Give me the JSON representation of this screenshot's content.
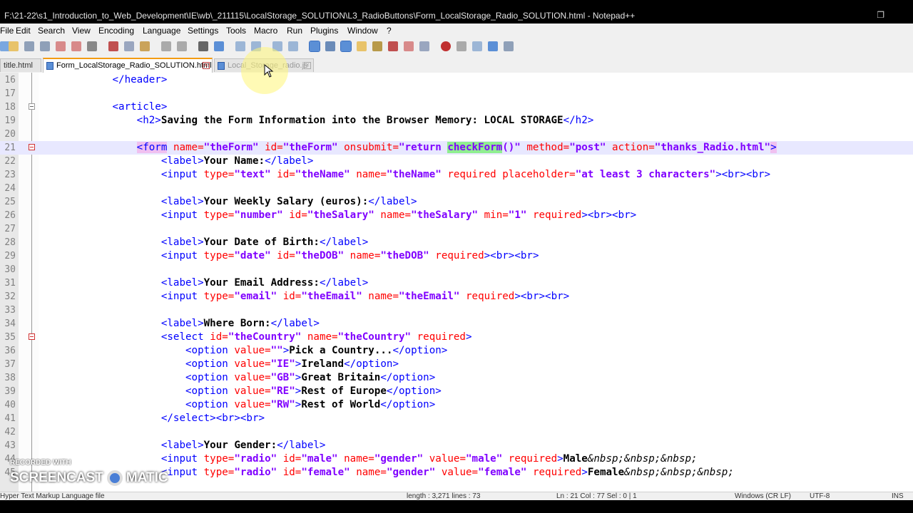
{
  "window": {
    "title": "F:\\21-22\\s1_Introduction_to_Web_Development\\IE\\wb\\_211115\\LocalStorage_SOLUTION\\L3_RadioButtons\\Form_LocalStorage_Radio_SOLUTION.html - Notepad++"
  },
  "menu": [
    "File",
    "Edit",
    "Search",
    "View",
    "Encoding",
    "Language",
    "Settings",
    "Tools",
    "Macro",
    "Run",
    "Plugins",
    "Window",
    "?"
  ],
  "tabs": [
    {
      "label": "title.html",
      "state": "inactive"
    },
    {
      "label": "Form_LocalStorage_Radio_SOLUTION.html",
      "state": "active"
    },
    {
      "label": "Local_Storage_radio.js",
      "state": "inactive"
    }
  ],
  "editor": {
    "lines": [
      {
        "num": "16",
        "fold": "line"
      },
      {
        "num": "17",
        "fold": "line"
      },
      {
        "num": "18",
        "fold": "box"
      },
      {
        "num": "19",
        "fold": "line"
      },
      {
        "num": "20",
        "fold": "line"
      },
      {
        "num": "21",
        "fold": "box-red",
        "current": true
      },
      {
        "num": "22",
        "fold": "line"
      },
      {
        "num": "23",
        "fold": "line"
      },
      {
        "num": "24",
        "fold": "line"
      },
      {
        "num": "25",
        "fold": "line"
      },
      {
        "num": "26",
        "fold": "line"
      },
      {
        "num": "27",
        "fold": "line"
      },
      {
        "num": "28",
        "fold": "line"
      },
      {
        "num": "29",
        "fold": "line"
      },
      {
        "num": "30",
        "fold": "line"
      },
      {
        "num": "31",
        "fold": "line"
      },
      {
        "num": "32",
        "fold": "line"
      },
      {
        "num": "33",
        "fold": "line"
      },
      {
        "num": "34",
        "fold": "line"
      },
      {
        "num": "35",
        "fold": "box-red"
      },
      {
        "num": "36",
        "fold": "line"
      },
      {
        "num": "37",
        "fold": "line"
      },
      {
        "num": "38",
        "fold": "line"
      },
      {
        "num": "39",
        "fold": "line"
      },
      {
        "num": "40",
        "fold": "line"
      },
      {
        "num": "41",
        "fold": "line"
      },
      {
        "num": "42",
        "fold": "line"
      },
      {
        "num": "43",
        "fold": "line"
      },
      {
        "num": "44",
        "fold": "line"
      },
      {
        "num": "45",
        "fold": "line"
      }
    ]
  },
  "status": {
    "filetype": "Hyper Text Markup Language file",
    "length": "length : 3,271    lines : 73",
    "position": "Ln : 21    Col : 77    Sel : 0 | 1",
    "eol": "Windows (CR LF)",
    "encoding": "UTF-8",
    "mode": "INS"
  },
  "watermark": {
    "recorded": "RECORDED WITH",
    "brand_left": "SCREENCAST",
    "brand_right": "MATIC"
  },
  "colors": {
    "tag": "#0000ff",
    "attribute": "#ff0000",
    "value": "#8000ff",
    "current_line": "#e8e8ff",
    "active_tab_accent": "#f39c12"
  }
}
